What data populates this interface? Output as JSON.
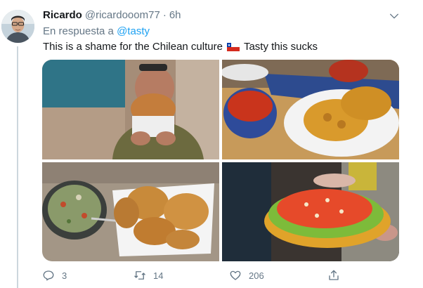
{
  "tweet": {
    "author_name": "Ricardo",
    "author_handle": "@ricardooom77",
    "separator": "·",
    "time": "6h",
    "reply_prefix": "En respuesta a",
    "reply_mention": "@tasty",
    "text_before_flag": "This is a shame for the Chilean culture",
    "flag_icon": "chile-flag-emoji",
    "text_after_flag": "Tasty this sucks",
    "photos": [
      {
        "icon": "photo-man-eating-sopaipilla"
      },
      {
        "icon": "photo-sopaipillas-with-salsa-bowl"
      },
      {
        "icon": "photo-pebre-bowl-and-sopaipillas"
      },
      {
        "icon": "photo-sopaipilla-with-guacamole-and-salsa"
      }
    ],
    "actions": {
      "reply_count": "3",
      "retweet_count": "14",
      "like_count": "206",
      "share_label": ""
    }
  },
  "colors": {
    "link": "#1da1f2",
    "secondary_text": "#657786",
    "primary_text": "#14171a",
    "thread_line": "#ccd6dd"
  }
}
